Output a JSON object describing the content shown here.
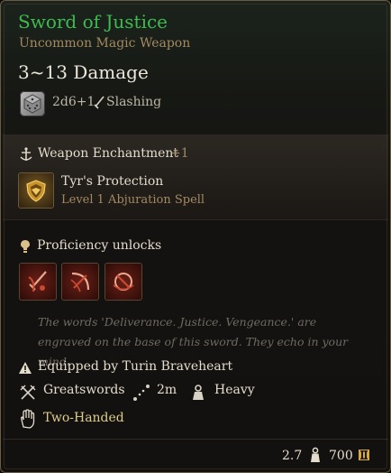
{
  "item": {
    "name": "Sword of Justice",
    "rarity_type": "Uncommon Magic Weapon",
    "damage": "3~13 Damage",
    "dice": "2d6+1",
    "damage_type": "Slashing"
  },
  "enchantment": {
    "label": "Weapon Enchantment",
    "bonus": "+1",
    "spell_name": "Tyr's Protection",
    "spell_level": "Level 1 Abjuration Spell"
  },
  "proficiency": {
    "label": "Proficiency unlocks",
    "actions": [
      "action-icon-1",
      "action-icon-2",
      "action-icon-3"
    ]
  },
  "flavor_text": "The words 'Deliverance. Justice. Vengeance.' are engraved on the base of this sword. They echo in your mind.",
  "equipped_by": "Equipped by Turin Braveheart",
  "properties": {
    "category": "Greatswords",
    "range": "2m",
    "weight_class": "Heavy",
    "handedness": "Two-Handed"
  },
  "footer": {
    "weight": "2.7",
    "value": "700"
  },
  "colors": {
    "title": "#3dbb4f",
    "subtitle": "#a48a60",
    "handedness": "#dccd8a"
  }
}
